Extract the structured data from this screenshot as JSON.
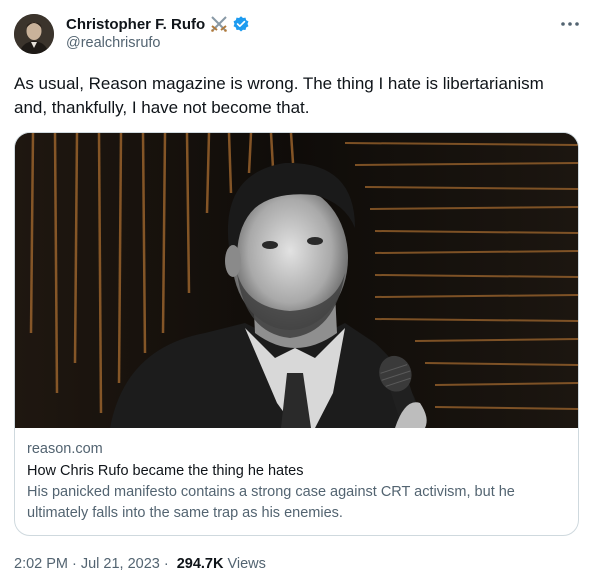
{
  "author": {
    "display_name": "Christopher F. Rufo",
    "handle": "@realchrisrufo",
    "emoji": "crossed-swords-icon",
    "verified": true
  },
  "tweet": {
    "text_line1": "As usual, Reason magazine is wrong. The thing I hate is libertarianism",
    "text_line2": "and, thankfully, I have not become that."
  },
  "card": {
    "domain": "reason.com",
    "title": "How Chris Rufo became the thing he hates",
    "desc_line1": "His panicked manifesto contains a strong case against CRT activism, but he",
    "desc_line2": "ultimately falls into the same trap as his enemies."
  },
  "meta": {
    "time": "2:02 PM",
    "date": "Jul 21, 2023",
    "dot1": "·",
    "dot2": "·",
    "views_count": "294.7K",
    "views_label": "Views"
  },
  "colors": {
    "text": "#0f1419",
    "secondary": "#536471",
    "verified": "#1d9bf0",
    "border": "#cfd9de"
  }
}
